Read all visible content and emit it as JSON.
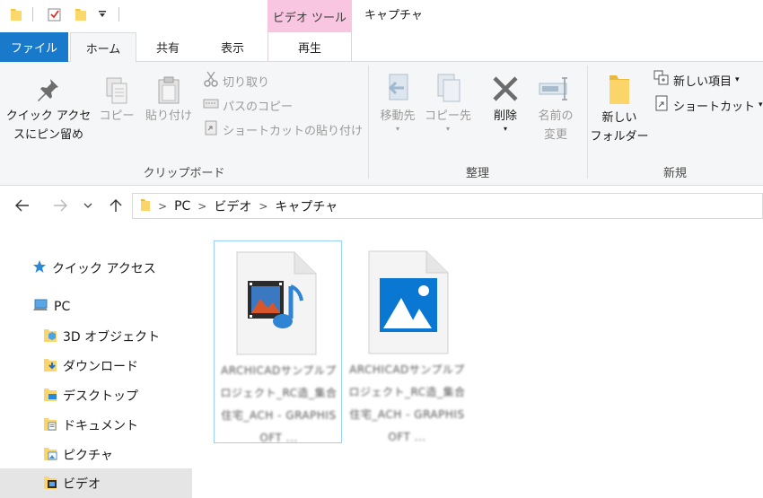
{
  "titlebar": {
    "context_header": "ビデオ ツール",
    "window_title": "キャプチャ"
  },
  "tabs": {
    "file": "ファイル",
    "home": "ホーム",
    "share": "共有",
    "view": "表示",
    "play": "再生"
  },
  "ribbon": {
    "clipboard": {
      "pin_line1": "クイック アクセ",
      "pin_line2": "スにピン留め",
      "copy": "コピー",
      "paste": "貼り付け",
      "cut": "切り取り",
      "copy_path": "パスのコピー",
      "paste_shortcut": "ショートカットの貼り付け",
      "label": "クリップボード"
    },
    "organize": {
      "move_to": "移動先",
      "copy_to": "コピー先",
      "delete": "削除",
      "rename_line1": "名前の",
      "rename_line2": "変更",
      "label": "整理"
    },
    "new": {
      "folder_line1": "新しい",
      "folder_line2": "フォルダー",
      "new_item": "新しい項目",
      "shortcut": "ショートカット",
      "label": "新規"
    }
  },
  "address": {
    "crumbs": [
      "PC",
      "ビデオ",
      "キャプチャ"
    ]
  },
  "navpane": {
    "quick_access": "クイック アクセス",
    "pc": "PC",
    "objects3d": "3D オブジェクト",
    "downloads": "ダウンロード",
    "desktop": "デスクトップ",
    "documents": "ドキュメント",
    "pictures": "ピクチャ",
    "videos": "ビデオ"
  },
  "files": [
    {
      "name": "ARCHICADサンプルプロジェクト_RC造_集合住宅_ACH - GRAPHISOFT ...",
      "type": "video"
    },
    {
      "name": "ARCHICADサンプルプロジェクト_RC造_集合住宅_ACH - GRAPHISOFT ...",
      "type": "image"
    }
  ],
  "colors": {
    "file_tab": "#1979ca",
    "context_tab": "#f9c6e1",
    "selection": "#cce8ff",
    "accent_blue": "#0078d7"
  }
}
